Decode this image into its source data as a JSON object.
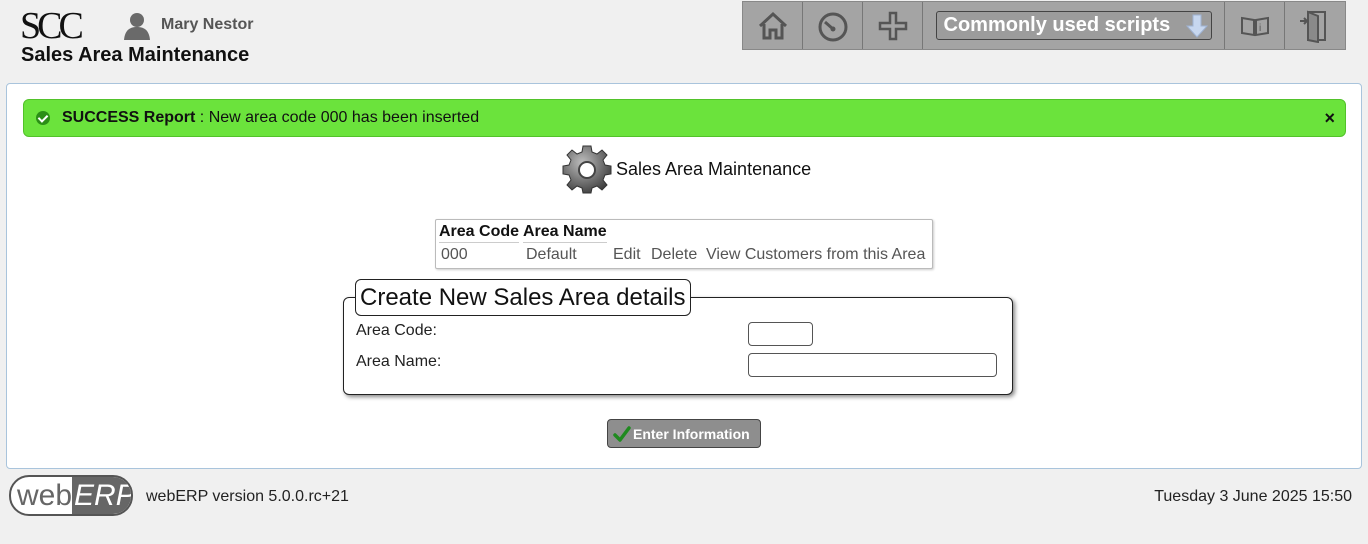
{
  "header": {
    "logo_text": "SCC",
    "user_name": "Mary Nestor",
    "page_title": "Sales Area Maintenance",
    "toolbar": {
      "scripts_label": "Commonly used scripts",
      "icons": [
        "home-icon",
        "dashboard-icon",
        "plus-icon",
        "manual-icon",
        "logout-icon"
      ]
    }
  },
  "success": {
    "prefix": "SUCCESS Report",
    "message": " : New area code 000 has been inserted",
    "close": "×"
  },
  "section": {
    "title": "Sales Area Maintenance"
  },
  "table": {
    "headers": [
      "Area Code",
      "Area Name"
    ],
    "rows": [
      {
        "code": "000",
        "name": "Default",
        "edit": "Edit",
        "delete": "Delete",
        "view": "View Customers from this Area"
      }
    ]
  },
  "form": {
    "legend": "Create New Sales Area details",
    "area_code_label": "Area Code:",
    "area_code_value": "",
    "area_name_label": "Area Name:",
    "area_name_value": "",
    "submit_label": "Enter Information"
  },
  "footer": {
    "logo_web": "web",
    "logo_erp": "ERP",
    "version": "webERP version 5.0.0.rc+21",
    "datetime": "Tuesday 3 June 2025 15:50"
  },
  "colors": {
    "success_bg": "#6be33c",
    "toolbar_bg": "#a4a4a4",
    "panel_border": "#a9c4dc"
  }
}
